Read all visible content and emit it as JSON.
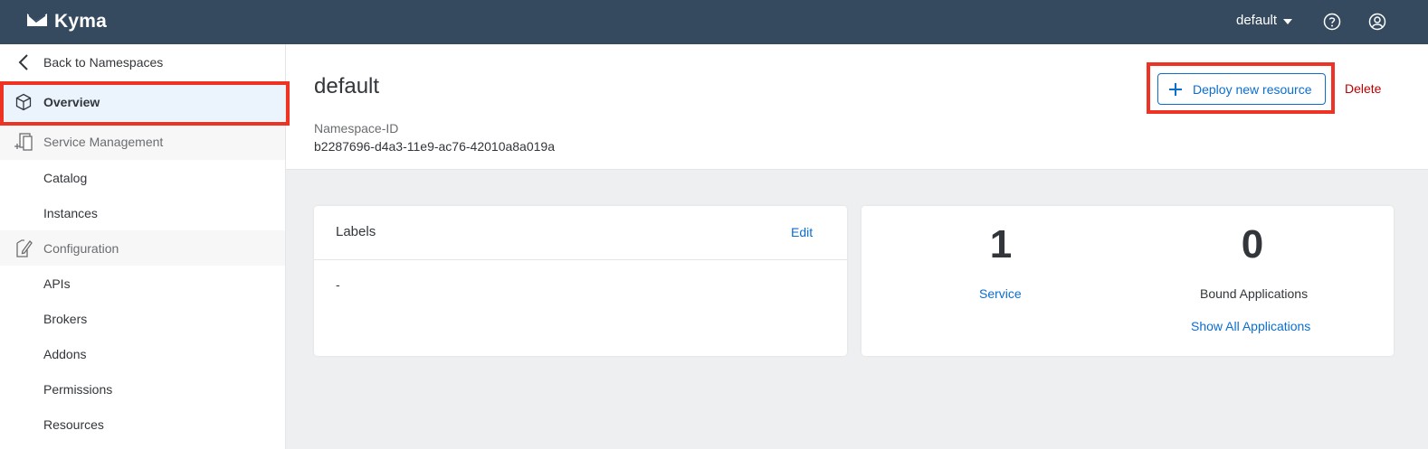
{
  "shell": {
    "brand": "Kyma",
    "namespace_selector": "default"
  },
  "sidebar": {
    "back_label": "Back to Namespaces",
    "overview_label": "Overview",
    "service_management_label": "Service Management",
    "service_items": [
      {
        "label": "Catalog"
      },
      {
        "label": "Instances"
      }
    ],
    "configuration_label": "Configuration",
    "config_items": [
      {
        "label": "APIs"
      },
      {
        "label": "Brokers"
      },
      {
        "label": "Addons"
      },
      {
        "label": "Permissions"
      },
      {
        "label": "Resources"
      }
    ]
  },
  "header": {
    "title": "default",
    "namespace_id_label": "Namespace-ID",
    "namespace_id_value": "b2287696-d4a3-11e9-ac76-42010a8a019a",
    "deploy_label": "Deploy new resource",
    "delete_label": "Delete"
  },
  "labels_panel": {
    "title": "Labels",
    "edit_label": "Edit",
    "body": "-"
  },
  "stats": {
    "service_count": "1",
    "service_label": "Service",
    "bound_apps_count": "0",
    "bound_apps_label": "Bound Applications",
    "show_all_label": "Show All Applications"
  },
  "colors": {
    "shell_bg": "#354a5f",
    "accent": "#0a6ed1",
    "danger": "#bb0000",
    "highlight_box": "#ee3224",
    "selected_bg": "#ebf4fd"
  }
}
